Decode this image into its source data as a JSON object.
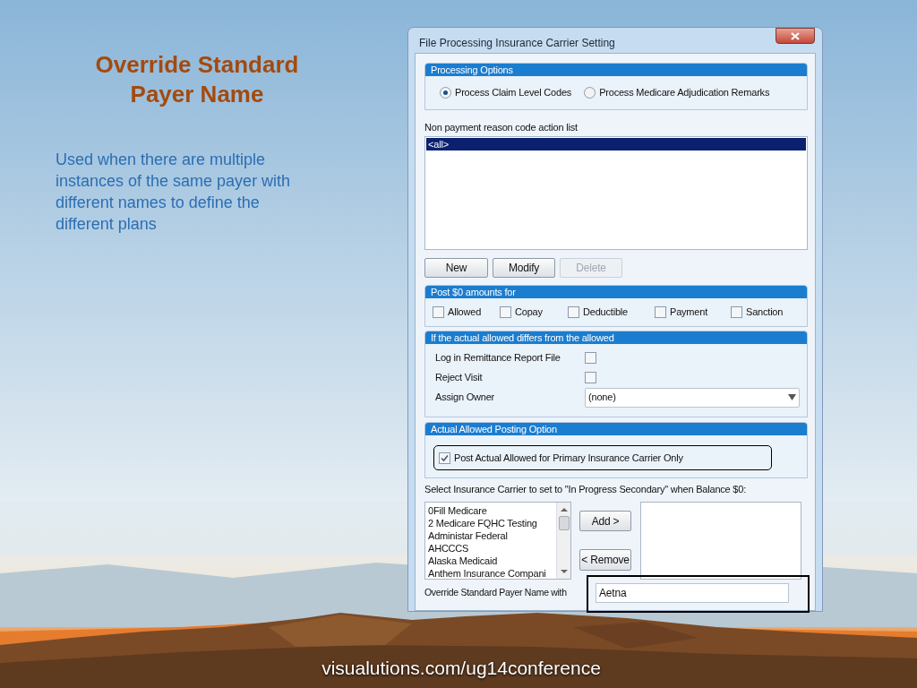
{
  "slide": {
    "title": "Override Standard Payer Name",
    "description": "Used when there are multiple instances of the same payer with different names to define the different plans",
    "footer": "visualutions.com/ug14conference"
  },
  "window": {
    "title": "File Processing Insurance Carrier Setting"
  },
  "processing_options": {
    "title": "Processing Options",
    "radios": [
      {
        "label": "Process Claim Level Codes",
        "selected": true
      },
      {
        "label": "Process Medicare Adjudication Remarks",
        "selected": false
      }
    ]
  },
  "action_list": {
    "label": "Non payment reason code action list",
    "items": [
      {
        "text": "<all>",
        "selected": true
      }
    ]
  },
  "action_buttons": [
    {
      "label": "New",
      "disabled": false
    },
    {
      "label": "Modify",
      "disabled": false
    },
    {
      "label": "Delete",
      "disabled": true
    }
  ],
  "post_zero": {
    "title": "Post $0 amounts for",
    "checkboxes": [
      {
        "label": "Allowed",
        "checked": false
      },
      {
        "label": "Copay",
        "checked": false
      },
      {
        "label": "Deductible",
        "checked": false
      },
      {
        "label": "Payment",
        "checked": false
      },
      {
        "label": "Sanction",
        "checked": false
      }
    ]
  },
  "allowed_differs": {
    "title": "If the actual allowed differs from the allowed",
    "rows": [
      {
        "kind": "checkbox",
        "label": "Log in Remittance Report File",
        "checked": false
      },
      {
        "kind": "checkbox",
        "label": "Reject Visit",
        "checked": false
      },
      {
        "kind": "dropdown",
        "label": "Assign Owner",
        "value": "(none)"
      }
    ]
  },
  "posting_option": {
    "title": "Actual Allowed Posting Option",
    "checkbox": {
      "label": "Post Actual Allowed for Primary Insurance Carrier Only",
      "checked": true
    }
  },
  "carrier_select": {
    "label": "Select Insurance Carrier to set to \"In Progress Secondary\" when Balance $0:",
    "available": [
      "0Fill Medicare",
      "2 Medicare FQHC Testing",
      "Administar Federal",
      "AHCCCS",
      "Alaska Medicaid",
      "Anthem Insurance Compani"
    ],
    "add_button": "Add >",
    "remove_button": "< Remove"
  },
  "override": {
    "label": "Override Standard Payer Name with",
    "value": "Aetna"
  }
}
